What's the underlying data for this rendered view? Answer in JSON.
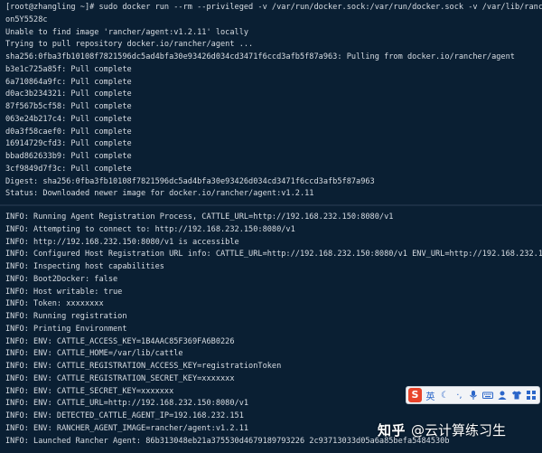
{
  "terminal": {
    "top_lines": [
      "[root@zhangling ~]# sudo docker run --rm --privileged -v /var/run/docker.sock:/var/run/docker.sock -v /var/lib/ranc",
      "on5Y5528c",
      "Unable to find image 'rancher/agent:v1.2.11' locally",
      "Trying to pull repository docker.io/rancher/agent ...",
      "sha256:0fba3fb10108f7821596dc5ad4bfa30e93426d034cd3471f6ccd3afb5f87a963: Pulling from docker.io/rancher/agent",
      "b3e1c725a85f: Pull complete",
      "6a710864a9fc: Pull complete",
      "d0ac3b234321: Pull complete",
      "87f567b5cf58: Pull complete",
      "063e24b217c4: Pull complete",
      "d0a3f58caef0: Pull complete",
      "16914729cfd3: Pull complete",
      "bbad862633b9: Pull complete",
      "3cf9849d7f3c: Pull complete",
      "Digest: sha256:0fba3fb10108f7821596dc5ad4bfa30e93426d034cd3471f6ccd3afb5f87a963",
      "Status: Downloaded newer image for docker.io/rancher/agent:v1.2.11"
    ],
    "bottom_lines": [
      "INFO: Running Agent Registration Process, CATTLE_URL=http://192.168.232.150:8080/v1",
      "INFO: Attempting to connect to: http://192.168.232.150:8080/v1",
      "INFO: http://192.168.232.150:8080/v1 is accessible",
      "INFO: Configured Host Registration URL info: CATTLE_URL=http://192.168.232.150:8080/v1 ENV_URL=http://192.168.232.1",
      "INFO: Inspecting host capabilities",
      "INFO: Boot2Docker: false",
      "INFO: Host writable: true",
      "INFO: Token: xxxxxxxx",
      "INFO: Running registration",
      "INFO: Printing Environment",
      "INFO: ENV: CATTLE_ACCESS_KEY=1B4AAC85F369FA6B0226",
      "INFO: ENV: CATTLE_HOME=/var/lib/cattle",
      "INFO: ENV: CATTLE_REGISTRATION_ACCESS_KEY=registrationToken",
      "INFO: ENV: CATTLE_REGISTRATION_SECRET_KEY=xxxxxxx",
      "INFO: ENV: CATTLE_SECRET_KEY=xxxxxxx",
      "INFO: ENV: CATTLE_URL=http://192.168.232.150:8080/v1",
      "INFO: ENV: DETECTED_CATTLE_AGENT_IP=192.168.232.151",
      "INFO: ENV: RANCHER_AGENT_IMAGE=rancher/agent:v1.2.11",
      "INFO: Launched Rancher Agent: 86b313048eb21a375530d4679189793226 2c93713033d05a6a85befa5484530b"
    ]
  },
  "ime": {
    "logo": "S",
    "mode_label": "英",
    "icons": [
      "moon-icon",
      "punctuation-icon",
      "microphone-icon",
      "keyboard-icon",
      "skin-icon",
      "shirt-icon",
      "grid-icon"
    ],
    "moon_glyph": "☾",
    "punct_glyph": "·,"
  },
  "watermark": {
    "brand": "知乎",
    "author": "@云计算练习生"
  },
  "colors": {
    "terminal_bg": "#0a1f33",
    "terminal_fg": "#d8dde3",
    "ime_accent": "#2b66c9",
    "ime_logo": "#e8442b"
  }
}
